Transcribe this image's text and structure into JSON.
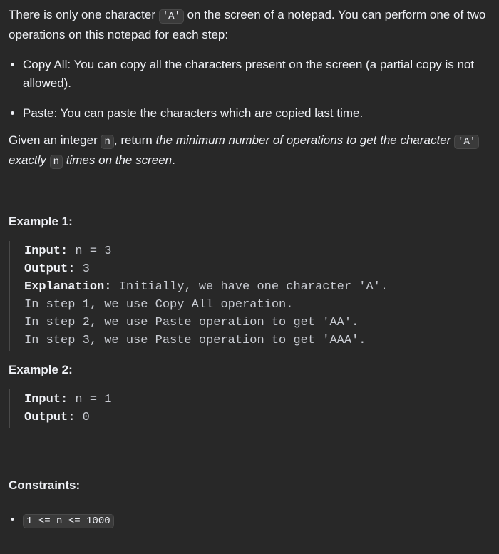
{
  "intro": {
    "t1": "There is only one character ",
    "code_a": "'A'",
    "t2": " on the screen of a notepad. You can perform one of two operations on this notepad for each step:"
  },
  "operations": [
    "Copy All: You can copy all the characters present on the screen (a partial copy is not allowed).",
    "Paste: You can paste the characters which are copied last time."
  ],
  "given": {
    "t1": "Given an integer ",
    "code_n": "n",
    "t2": ", return ",
    "em1": "the minimum number of operations to get the character ",
    "code_a": "'A'",
    "em2": " exactly ",
    "code_n2": "n",
    "em3": " times on the screen",
    "t3": "."
  },
  "example1": {
    "title": "Example 1:",
    "input_label": "Input:",
    "input_value": " n = 3",
    "output_label": "Output:",
    "output_value": " 3",
    "explanation_label": "Explanation:",
    "explanation_value": " Initially, we have one character 'A'.",
    "line2": "In step 1, we use Copy All operation.",
    "line3": "In step 2, we use Paste operation to get 'AA'.",
    "line4": "In step 3, we use Paste operation to get 'AAA'."
  },
  "example2": {
    "title": "Example 2:",
    "input_label": "Input:",
    "input_value": " n = 1",
    "output_label": "Output:",
    "output_value": " 0"
  },
  "constraints": {
    "title": "Constraints:",
    "items": [
      "1 <= n <= 1000"
    ]
  }
}
